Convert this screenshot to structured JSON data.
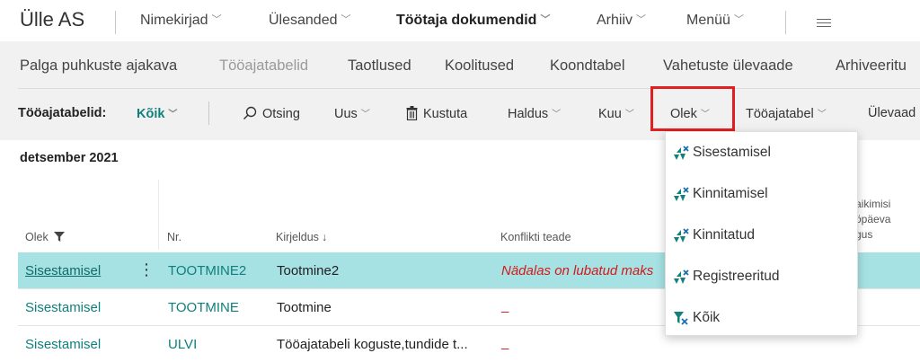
{
  "header": {
    "company": "Ülle AS",
    "nav": [
      {
        "label": "Nimekirjad"
      },
      {
        "label": "Ülesanded"
      },
      {
        "label": "Töötaja dokumendid"
      },
      {
        "label": "Arhiiv"
      },
      {
        "label": "Menüü"
      }
    ],
    "menu_icon": "hamburger-icon"
  },
  "subnav": {
    "items": [
      {
        "label": "Palga puhkuste ajakava"
      },
      {
        "label": "Tööajatabelid"
      },
      {
        "label": "Taotlused"
      },
      {
        "label": "Koolitused"
      },
      {
        "label": "Koondtabel"
      },
      {
        "label": "Vahetuste ülevaade"
      },
      {
        "label": "Arhiveeritu"
      }
    ]
  },
  "actionbar": {
    "page_label": "Tööajatabelid:",
    "filter_value": "Kõik",
    "search_label": "Otsing",
    "new_label": "Uus",
    "delete_label": "Kustuta",
    "manage_label": "Haldus",
    "month_label": "Kuu",
    "status_label": "Olek",
    "timesheet_label": "Tööajatabel",
    "overview_label": "Ülevaad"
  },
  "section": {
    "title": "detsember 2021"
  },
  "table": {
    "headers": {
      "status": "Olek",
      "nr": "Nr.",
      "description": "Kirjeldus",
      "conflict": "Konflikti teade",
      "extra_line1": "aikimisi",
      "extra_line2": "öpäeva",
      "extra_line3": "gus"
    },
    "rows": [
      {
        "status": "Sisestamisel",
        "nr": "TOOTMINE2",
        "description": "Tootmine2",
        "conflict": "Nädalas on lubatud maks"
      },
      {
        "status": "Sisestamisel",
        "nr": "TOOTMINE",
        "description": "Tootmine",
        "conflict": "_"
      },
      {
        "status": "Sisestamisel",
        "nr": "ULVI",
        "description": "Tööajatabeli koguste,tundide t...",
        "conflict": "_"
      }
    ]
  },
  "status_dropdown": {
    "options": [
      {
        "label": "Sisestamisel"
      },
      {
        "label": "Kinnitamisel"
      },
      {
        "label": "Kinnitatud"
      },
      {
        "label": "Registreeritud"
      },
      {
        "label": "Kõik"
      }
    ]
  },
  "colors": {
    "accent": "#0e7f7b",
    "selected_row": "#a6e2e4",
    "highlight_box": "#e02020"
  }
}
